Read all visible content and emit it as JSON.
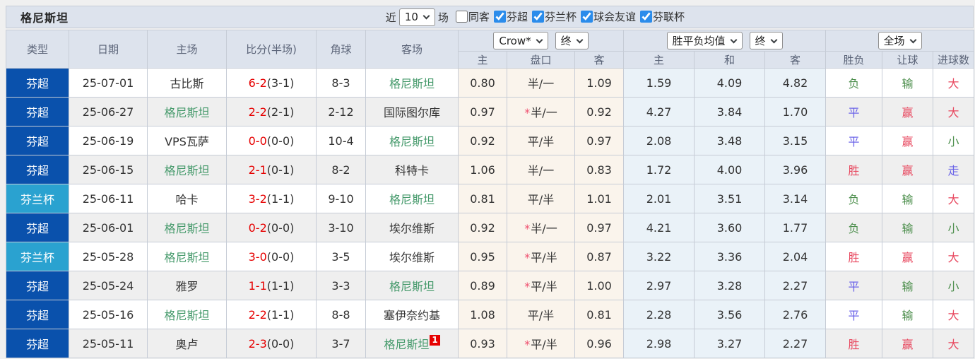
{
  "title": "格尼斯坦",
  "filter_bar": {
    "recent_label": "近",
    "recent_value": "10",
    "recent_suffix": "场",
    "checkboxes": [
      {
        "label": "同客",
        "checked": false
      },
      {
        "label": "芬超",
        "checked": true
      },
      {
        "label": "芬兰杯",
        "checked": true
      },
      {
        "label": "球会友谊",
        "checked": true
      },
      {
        "label": "芬联杯",
        "checked": true
      }
    ]
  },
  "header": {
    "columns": [
      "类型",
      "日期",
      "主场",
      "比分(半场)",
      "角球",
      "客场"
    ],
    "odds_group": {
      "company_select": "Crow*",
      "time_select": "终",
      "sub": [
        "主",
        "盘口",
        "客"
      ]
    },
    "europe_group": {
      "company_select": "胜平负均值",
      "time_select": "终",
      "sub": [
        "主",
        "和",
        "客"
      ]
    },
    "result_group": {
      "scope_select": "全场",
      "sub": [
        "胜负",
        "让球",
        "进球数"
      ]
    }
  },
  "colors": {
    "league_super": "#0a51ac",
    "league_cup": "#2aa2d0",
    "self_team_green": "#44996a",
    "score_red": "#e60000",
    "result_red": "#e8485f",
    "result_green": "#4d8f4d",
    "result_blue": "#6a63e8",
    "header_bg": "#dde3ed",
    "odds_col_bg": "#faf4ec",
    "europe_col_bg": "#eaf2f8",
    "checkbox_accent": "#2b8ceb"
  },
  "rows": [
    {
      "league": "芬超",
      "league_type": "super",
      "date": "25-07-01",
      "home": "古比斯",
      "home_self": false,
      "score": "6-2",
      "half": "(3-1)",
      "corners": "8-3",
      "away": "格尼斯坦",
      "away_self": true,
      "away_badge": "",
      "ah_home": "0.80",
      "handicap_star": "",
      "handicap": "半/一",
      "ah_away": "1.09",
      "eu_home": "1.59",
      "eu_draw": "4.09",
      "eu_away": "4.82",
      "result_wdl": {
        "text": "负",
        "tone": "green"
      },
      "result_handicap": {
        "text": "输",
        "tone": "green"
      },
      "result_goals": {
        "text": "大",
        "tone": "red"
      }
    },
    {
      "league": "芬超",
      "league_type": "super",
      "date": "25-06-27",
      "home": "格尼斯坦",
      "home_self": true,
      "score": "2-2",
      "half": "(2-1)",
      "corners": "2-12",
      "away": "国际图尔库",
      "away_self": false,
      "away_badge": "",
      "ah_home": "0.97",
      "handicap_star": "*",
      "handicap": "半/一",
      "ah_away": "0.92",
      "eu_home": "4.27",
      "eu_draw": "3.84",
      "eu_away": "1.70",
      "result_wdl": {
        "text": "平",
        "tone": "blue"
      },
      "result_handicap": {
        "text": "赢",
        "tone": "red"
      },
      "result_goals": {
        "text": "大",
        "tone": "red"
      }
    },
    {
      "league": "芬超",
      "league_type": "super",
      "date": "25-06-19",
      "home": "VPS瓦萨",
      "home_self": false,
      "score": "0-0",
      "half": "(0-0)",
      "corners": "10-4",
      "away": "格尼斯坦",
      "away_self": true,
      "away_badge": "",
      "ah_home": "0.92",
      "handicap_star": "",
      "handicap": "平/半",
      "ah_away": "0.97",
      "eu_home": "2.08",
      "eu_draw": "3.48",
      "eu_away": "3.15",
      "result_wdl": {
        "text": "平",
        "tone": "blue"
      },
      "result_handicap": {
        "text": "赢",
        "tone": "red"
      },
      "result_goals": {
        "text": "小",
        "tone": "green"
      }
    },
    {
      "league": "芬超",
      "league_type": "super",
      "date": "25-06-15",
      "home": "格尼斯坦",
      "home_self": true,
      "score": "2-1",
      "half": "(0-1)",
      "corners": "8-2",
      "away": "科特卡",
      "away_self": false,
      "away_badge": "",
      "ah_home": "1.06",
      "handicap_star": "",
      "handicap": "半/一",
      "ah_away": "0.83",
      "eu_home": "1.72",
      "eu_draw": "4.00",
      "eu_away": "3.96",
      "result_wdl": {
        "text": "胜",
        "tone": "red"
      },
      "result_handicap": {
        "text": "赢",
        "tone": "red"
      },
      "result_goals": {
        "text": "走",
        "tone": "blue"
      }
    },
    {
      "league": "芬兰杯",
      "league_type": "cup",
      "date": "25-06-11",
      "home": "哈卡",
      "home_self": false,
      "score": "3-2",
      "half": "(1-1)",
      "corners": "9-10",
      "away": "格尼斯坦",
      "away_self": true,
      "away_badge": "",
      "ah_home": "0.81",
      "handicap_star": "",
      "handicap": "平/半",
      "ah_away": "1.01",
      "eu_home": "2.01",
      "eu_draw": "3.51",
      "eu_away": "3.14",
      "result_wdl": {
        "text": "负",
        "tone": "green"
      },
      "result_handicap": {
        "text": "输",
        "tone": "green"
      },
      "result_goals": {
        "text": "大",
        "tone": "red"
      }
    },
    {
      "league": "芬超",
      "league_type": "super",
      "date": "25-06-01",
      "home": "格尼斯坦",
      "home_self": true,
      "score": "0-2",
      "half": "(0-0)",
      "corners": "3-10",
      "away": "埃尔维斯",
      "away_self": false,
      "away_badge": "",
      "ah_home": "0.92",
      "handicap_star": "*",
      "handicap": "半/一",
      "ah_away": "0.97",
      "eu_home": "4.21",
      "eu_draw": "3.60",
      "eu_away": "1.77",
      "result_wdl": {
        "text": "负",
        "tone": "green"
      },
      "result_handicap": {
        "text": "输",
        "tone": "green"
      },
      "result_goals": {
        "text": "小",
        "tone": "green"
      }
    },
    {
      "league": "芬兰杯",
      "league_type": "cup",
      "date": "25-05-28",
      "home": "格尼斯坦",
      "home_self": true,
      "score": "3-0",
      "half": "(0-0)",
      "corners": "3-5",
      "away": "埃尔维斯",
      "away_self": false,
      "away_badge": "",
      "ah_home": "0.95",
      "handicap_star": "*",
      "handicap": "平/半",
      "ah_away": "0.87",
      "eu_home": "3.22",
      "eu_draw": "3.36",
      "eu_away": "2.04",
      "result_wdl": {
        "text": "胜",
        "tone": "red"
      },
      "result_handicap": {
        "text": "赢",
        "tone": "red"
      },
      "result_goals": {
        "text": "大",
        "tone": "red"
      }
    },
    {
      "league": "芬超",
      "league_type": "super",
      "date": "25-05-24",
      "home": "雅罗",
      "home_self": false,
      "score": "1-1",
      "half": "(1-1)",
      "corners": "3-3",
      "away": "格尼斯坦",
      "away_self": true,
      "away_badge": "",
      "ah_home": "0.89",
      "handicap_star": "*",
      "handicap": "平/半",
      "ah_away": "1.00",
      "eu_home": "2.97",
      "eu_draw": "3.28",
      "eu_away": "2.27",
      "result_wdl": {
        "text": "平",
        "tone": "blue"
      },
      "result_handicap": {
        "text": "输",
        "tone": "green"
      },
      "result_goals": {
        "text": "小",
        "tone": "green"
      }
    },
    {
      "league": "芬超",
      "league_type": "super",
      "date": "25-05-16",
      "home": "格尼斯坦",
      "home_self": true,
      "score": "2-2",
      "half": "(1-1)",
      "corners": "8-8",
      "away": "塞伊奈约基",
      "away_self": false,
      "away_badge": "",
      "ah_home": "1.08",
      "handicap_star": "",
      "handicap": "平/半",
      "ah_away": "0.81",
      "eu_home": "2.28",
      "eu_draw": "3.56",
      "eu_away": "2.76",
      "result_wdl": {
        "text": "平",
        "tone": "blue"
      },
      "result_handicap": {
        "text": "输",
        "tone": "green"
      },
      "result_goals": {
        "text": "大",
        "tone": "red"
      }
    },
    {
      "league": "芬超",
      "league_type": "super",
      "date": "25-05-11",
      "home": "奥卢",
      "home_self": false,
      "score": "2-3",
      "half": "(0-0)",
      "corners": "3-7",
      "away": "格尼斯坦",
      "away_self": true,
      "away_badge": "1",
      "ah_home": "0.93",
      "handicap_star": "*",
      "handicap": "平/半",
      "ah_away": "0.96",
      "eu_home": "2.98",
      "eu_draw": "3.27",
      "eu_away": "2.27",
      "result_wdl": {
        "text": "胜",
        "tone": "red"
      },
      "result_handicap": {
        "text": "赢",
        "tone": "red"
      },
      "result_goals": {
        "text": "大",
        "tone": "red"
      }
    }
  ]
}
